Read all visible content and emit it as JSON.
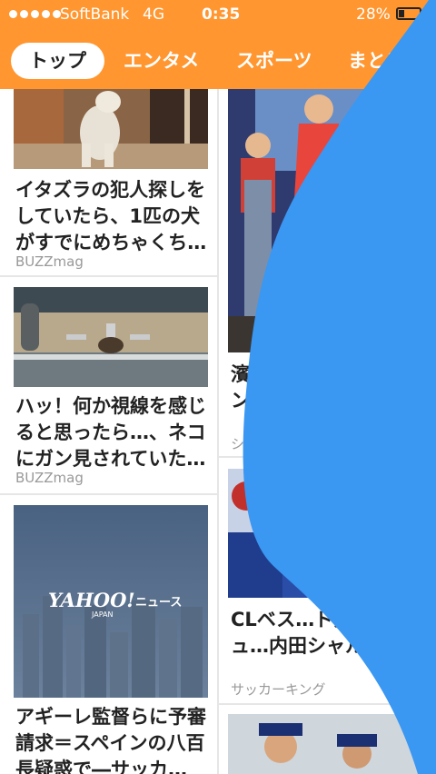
{
  "status": {
    "carrier": "SoftBank",
    "network": "4G",
    "time": "0:35",
    "battery_percent": "28%",
    "battery_level": 0.28
  },
  "tabs": [
    {
      "label": "トップ"
    },
    {
      "label": "エンタメ"
    },
    {
      "label": "スポーツ"
    },
    {
      "label": "まとめ"
    }
  ],
  "left_column": [
    {
      "title": "イタズラの犯人探しをしていたら、1匹の犬がすでにめちゃくち…",
      "source": "BUZZmag"
    },
    {
      "title": "ハッ！何か視線を感じると思ったら…、ネコにガン見されていた…",
      "source": "BUZZmag"
    },
    {
      "title": "アギーレ監督らに予審請求＝スペインの八百長疑惑で―サッカ…",
      "source": "",
      "logo_text": "YAHOO!",
      "logo_sub": "JAPAN",
      "logo_news": "ニュース"
    }
  ],
  "right_column": [
    {
      "title": "濱田龍…173…セン…",
      "source": "シネ…"
    },
    {
      "title": "CLベス…ド決定…ュ…内田シャルケ…",
      "source": "サッカーキング"
    }
  ]
}
